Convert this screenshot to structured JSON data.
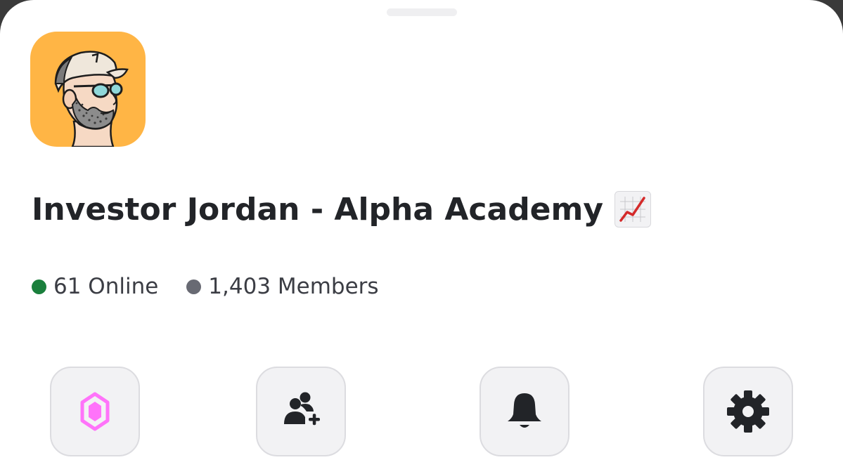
{
  "server": {
    "name": "Investor Jordan - Alpha Academy",
    "name_emoji": "chart-increasing-emoji",
    "icon": "avatar-illustration-bearded-man-cap-sunglasses",
    "icon_background": "#ffb545"
  },
  "stats": {
    "online": {
      "label": "61 Online",
      "color": "#1a7f3c"
    },
    "members": {
      "label": "1,403 Members",
      "color": "#686a73"
    }
  },
  "actions": [
    {
      "name": "boost",
      "icon": "nitro-boost-gem-icon",
      "color": "#ff73fa"
    },
    {
      "name": "invite",
      "icon": "add-member-icon",
      "color": "#222428"
    },
    {
      "name": "notifications",
      "icon": "bell-icon",
      "color": "#222428"
    },
    {
      "name": "settings",
      "icon": "gear-icon",
      "color": "#222428"
    }
  ],
  "colors": {
    "sheet_background": "#ffffff",
    "button_background": "#f2f2f4",
    "text_primary": "#222428",
    "text_secondary": "#3b3d44"
  }
}
